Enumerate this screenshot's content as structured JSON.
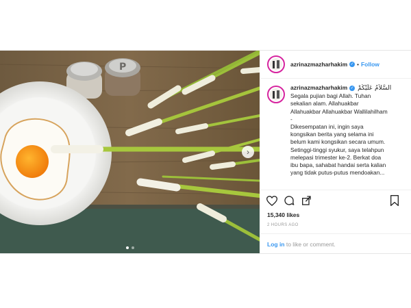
{
  "account": {
    "username": "azrinazmazharhakim",
    "follow_label": "Follow",
    "separator": "•"
  },
  "caption": {
    "username": "azrinazmazharhakim",
    "greeting_arabic": "السَّلاَمُ عَلَيْكُمْ",
    "lines": [
      "Segala pujian bagi Allah. Tuhan",
      "sekalian alam. Allahuakbar",
      "Allahuakbar Allahuakbar Wallilahilham",
      "-",
      "Dikesempatan ini, ingin saya",
      "kongsikan berita yang selama ini",
      "belum kami kongsikan secara umum.",
      "Setinggi-tinggi syukur, saya telahpun",
      "melepasi trimester ke-2. Berkat doa",
      "ibu bapa, sahabat handai serta kalian",
      "yang tidak putus-putus mendoakan..."
    ]
  },
  "actions": {
    "icons": [
      "heart-icon",
      "comment-icon",
      "share-icon",
      "bookmark-icon"
    ]
  },
  "likes": "15,340 likes",
  "timestamp": "2 HOURS AGO",
  "login": {
    "link": "Log in",
    "text": " to like or comment."
  },
  "carousel": {
    "current": 1,
    "total": 2
  },
  "colors": {
    "accent": "#3897f0",
    "story_ring": "#d6249f"
  }
}
